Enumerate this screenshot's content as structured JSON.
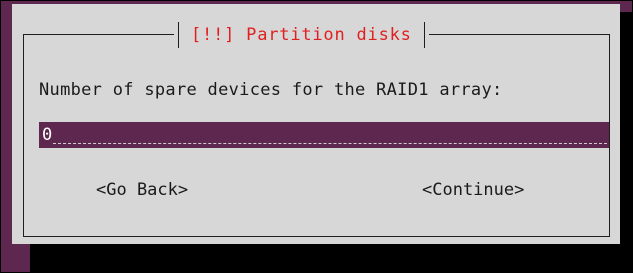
{
  "dialog": {
    "title": "[!!] Partition disks",
    "prompt": "Number of spare devices for the RAID1 array:",
    "input_value": "0",
    "go_back_label": "<Go Back>",
    "continue_label": "<Continue>"
  },
  "colors": {
    "background": "#5e2750",
    "dialog": "#d7d7d7",
    "title": "#e02020",
    "input_bg": "#5e2750",
    "shadow": "#000000"
  }
}
